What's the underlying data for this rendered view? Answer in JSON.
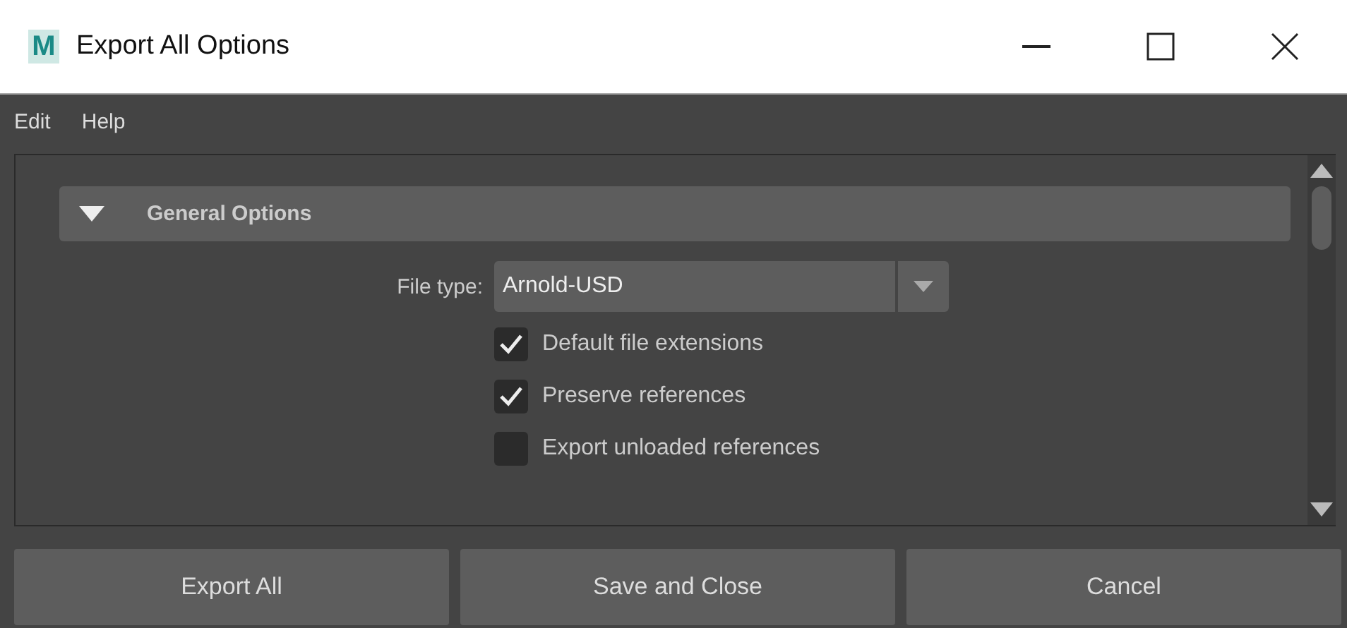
{
  "window": {
    "logo": "M",
    "title": "Export All Options"
  },
  "menu": [
    "Edit",
    "Help"
  ],
  "section": {
    "title": "General Options",
    "expanded": true
  },
  "file_type": {
    "label": "File type:",
    "value": "Arnold-USD"
  },
  "options": [
    {
      "label": "Default file extensions",
      "checked": true
    },
    {
      "label": "Preserve references",
      "checked": true
    },
    {
      "label": "Export unloaded references",
      "checked": false
    }
  ],
  "buttons": [
    "Export All",
    "Save and Close",
    "Cancel"
  ]
}
